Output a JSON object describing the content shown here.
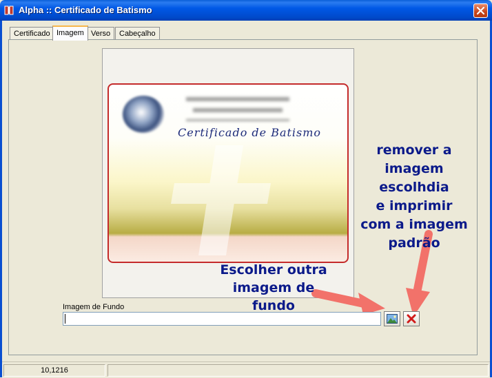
{
  "window": {
    "title": "Alpha :: Certificado de Batismo",
    "icon": "book-icon",
    "close_icon": "close-icon"
  },
  "tabs": [
    {
      "label": "Certificado",
      "active": false
    },
    {
      "label": "Imagem",
      "active": true
    },
    {
      "label": "Verso",
      "active": false
    },
    {
      "label": "Cabeçalho",
      "active": false
    }
  ],
  "preview": {
    "certificate_title": "Certificado de Batismo",
    "seal_icon": "church-seal-icon",
    "watermark_icon": "cross-icon"
  },
  "annotations": {
    "remove": [
      "remover a",
      "imagem escolhdia",
      "e imprimir",
      "com a imagem",
      "padrão"
    ],
    "choose": [
      "Escolher outra",
      "imagem de",
      "fundo"
    ]
  },
  "field": {
    "label": "Imagem de Fundo",
    "value": ""
  },
  "buttons": {
    "choose_icon": "image-icon",
    "remove_icon": "delete-x-icon"
  },
  "colors": {
    "annotation_text": "#0b1a8a",
    "arrow": "#f2726a",
    "titlebar": "#0058e6"
  },
  "status": {
    "version": "10,1216"
  }
}
